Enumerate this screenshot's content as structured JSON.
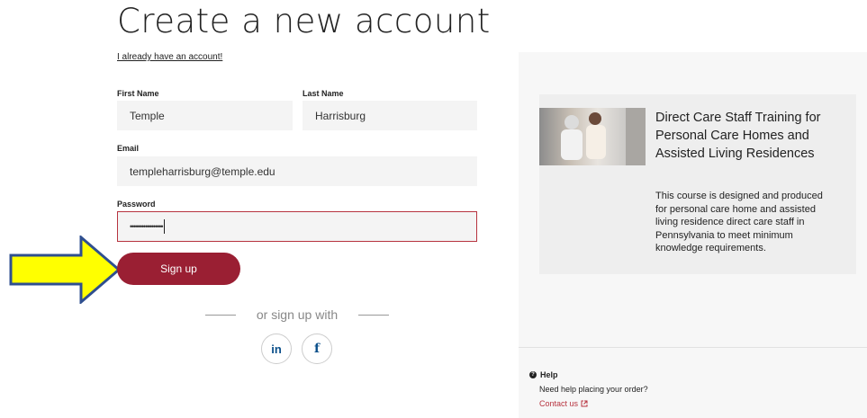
{
  "page": {
    "title": "Create a new account",
    "signin_link": "I already have an account!"
  },
  "form": {
    "first_name": {
      "label": "First Name",
      "value": "Temple"
    },
    "last_name": {
      "label": "Last Name",
      "value": "Harrisburg"
    },
    "email": {
      "label": "Email",
      "value": "templeharrisburg@temple.edu"
    },
    "password": {
      "label": "Password",
      "value": "•••••••••••••••••"
    },
    "submit_label": "Sign up",
    "divider_text": "or sign up with",
    "social": [
      {
        "name": "linkedin",
        "glyph": "in"
      },
      {
        "name": "facebook",
        "glyph": "f"
      }
    ]
  },
  "course": {
    "title": "Direct Care Staff Training for Personal Care Homes and Assisted Living Residences",
    "description": "This course is designed and produced for personal care home and assisted living residence direct care staff in Pennsylvania to meet minimum knowledge requirements."
  },
  "help": {
    "heading": "Help",
    "text": "Need help placing your order?",
    "contact_label": "Contact us"
  },
  "colors": {
    "primary": "#9a1f33",
    "error_border": "#b7333f",
    "arrow_fill": "#ffff00",
    "arrow_stroke": "#2f4f8f"
  }
}
